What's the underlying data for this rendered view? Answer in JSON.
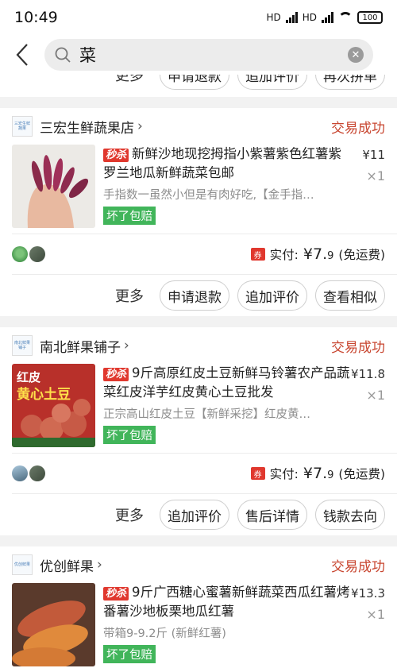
{
  "status_bar": {
    "time": "10:49",
    "net1": "HD",
    "net2": "HD",
    "battery": "100"
  },
  "search": {
    "value": "菜",
    "clear_icon": "clear-icon"
  },
  "top_partial_actions": [
    "更多",
    "申请退款",
    "追加评价",
    "再次拼单"
  ],
  "orders": [
    {
      "shop_logo_text": "三宏生鲜蔬果",
      "shop_name": "三宏生鲜蔬果店",
      "status": "交易成功",
      "flash_tag": "秒杀",
      "title": "新鲜沙地现挖拇指小紫薯紫色红薯紫罗兰地瓜新鲜蔬菜包邮",
      "subtitle": "手指数一虽然小但是有肉好吃,【金手指…",
      "guarantee": "坏了包赔",
      "price": "¥11",
      "qty": "×1",
      "pay_label": "实付:",
      "pay_amount_int": "¥7.",
      "pay_amount_dec": "9",
      "pay_note": "(免运费)",
      "actions": [
        "更多",
        "申请退款",
        "追加评价",
        "查看相似"
      ]
    },
    {
      "shop_logo_text": "南北鲜果铺子",
      "shop_name": "南北鲜果铺子",
      "status": "交易成功",
      "flash_tag": "秒杀",
      "title": "9斤高原红皮土豆新鲜马铃薯农产品蔬菜红皮洋芋红皮黄心土豆批发",
      "subtitle": "正宗高山红皮土豆【新鲜采挖】红皮黄…",
      "guarantee": "坏了包赔",
      "price": "¥11.8",
      "qty": "×1",
      "pay_label": "实付:",
      "pay_amount_int": "¥7.",
      "pay_amount_dec": "9",
      "pay_note": "(免运费)",
      "actions": [
        "更多",
        "追加评价",
        "售后详情",
        "钱款去向"
      ]
    },
    {
      "shop_logo_text": "优创鲜果",
      "shop_name": "优创鲜果",
      "status": "交易成功",
      "flash_tag": "秒杀",
      "title": "9斤广西糖心蜜薯新鲜蔬菜西瓜红薯烤番薯沙地板栗地瓜红薯",
      "subtitle": "带箱9-9.2斤 (新鲜红薯)",
      "guarantee": "坏了包赔",
      "price": "¥13.3",
      "qty": "×1"
    }
  ],
  "thumb_texts": {
    "potato_line1": "红皮",
    "potato_line2": "黄心土豆"
  },
  "colors": {
    "status_red": "#c8452f",
    "flash_red": "#e0382e",
    "guarantee_green": "#41b55a"
  }
}
